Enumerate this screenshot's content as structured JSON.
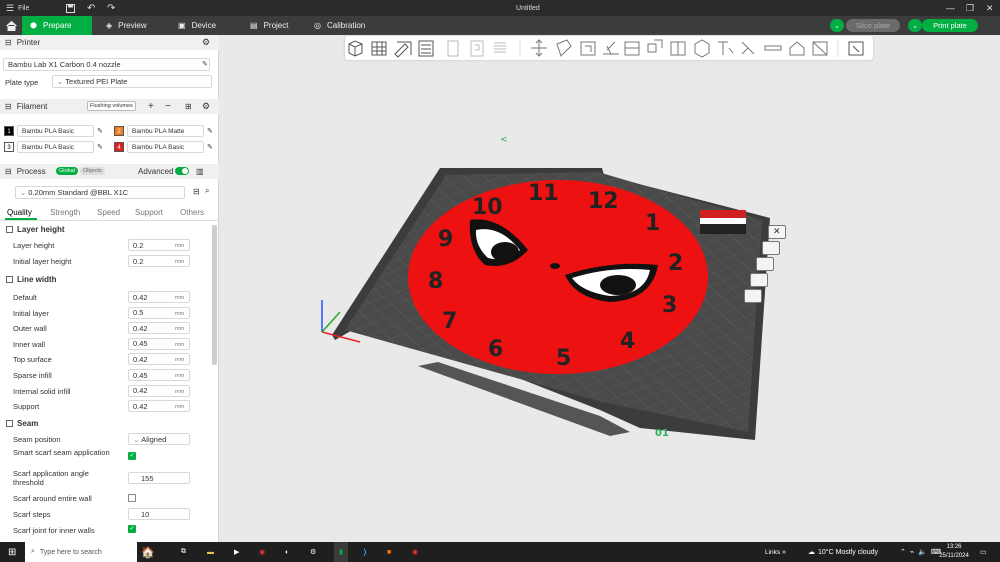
{
  "titlebar": {
    "menu_label": "File",
    "doc_title": "Untitled"
  },
  "nav": {
    "tabs": [
      {
        "label": "Prepare"
      },
      {
        "label": "Preview"
      },
      {
        "label": "Device"
      },
      {
        "label": "Project"
      },
      {
        "label": "Calibration"
      }
    ],
    "slice_label": "Slice plate",
    "print_label": "Print plate"
  },
  "printer": {
    "header": "Printer",
    "name": "Bambu Lab X1 Carbon 0.4 nozzle",
    "plate_type_label": "Plate type",
    "plate_type_value": "Textured PEI Plate"
  },
  "filament": {
    "header": "Filament",
    "flushing_label": "Flushing volumes",
    "items": [
      {
        "num": "1",
        "name": "Bambu PLA Basic",
        "color": "#000000"
      },
      {
        "num": "2",
        "name": "Bambu PLA Matte",
        "color": "#f47b20"
      },
      {
        "num": "3",
        "name": "Bambu PLA Basic",
        "color": "#ffffff"
      },
      {
        "num": "4",
        "name": "Bambu PLA Basic",
        "color": "#e0201b"
      }
    ]
  },
  "process": {
    "header": "Process",
    "global_label": "Global",
    "objects_label": "Objects",
    "advanced_label": "Advanced",
    "preset": "0.20mm Standard @BBL X1C",
    "tabs": [
      "Quality",
      "Strength",
      "Speed",
      "Support",
      "Others"
    ]
  },
  "layer_height": {
    "header": "Layer height",
    "rows": [
      {
        "label": "Layer height",
        "value": "0.2",
        "unit": "mm"
      },
      {
        "label": "Initial layer height",
        "value": "0.2",
        "unit": "mm"
      }
    ]
  },
  "line_width": {
    "header": "Line width",
    "rows": [
      {
        "label": "Default",
        "value": "0.42",
        "unit": "mm"
      },
      {
        "label": "Initial layer",
        "value": "0.5",
        "unit": "mm"
      },
      {
        "label": "Outer wall",
        "value": "0.42",
        "unit": "mm"
      },
      {
        "label": "Inner wall",
        "value": "0.45",
        "unit": "mm"
      },
      {
        "label": "Top surface",
        "value": "0.42",
        "unit": "mm"
      },
      {
        "label": "Sparse infill",
        "value": "0.45",
        "unit": "mm"
      },
      {
        "label": "Internal solid infill",
        "value": "0.42",
        "unit": "mm"
      },
      {
        "label": "Support",
        "value": "0.42",
        "unit": "mm"
      }
    ]
  },
  "seam": {
    "header": "Seam",
    "position_label": "Seam position",
    "position_value": "Aligned",
    "smart_scarf_label": "Smart scarf seam application",
    "scarf_angle_label": "Scarf application angle threshold",
    "scarf_angle_value": "155",
    "scarf_entire_label": "Scarf around entire wall",
    "scarf_steps_label": "Scarf steps",
    "scarf_steps_value": "10",
    "scarf_inner_label": "Scarf joint for inner walls"
  },
  "plate": {
    "number": "01",
    "clock_numbers": [
      "12",
      "1",
      "2",
      "3",
      "4",
      "5",
      "6",
      "7",
      "8",
      "9",
      "10",
      "11"
    ],
    "clock_color": "#ee1111"
  },
  "taskbar": {
    "search_placeholder": "Type here to search",
    "links_label": "Links",
    "weather": "10°C  Mostly cloudy",
    "time": "13:26",
    "date": "25/11/2024"
  }
}
